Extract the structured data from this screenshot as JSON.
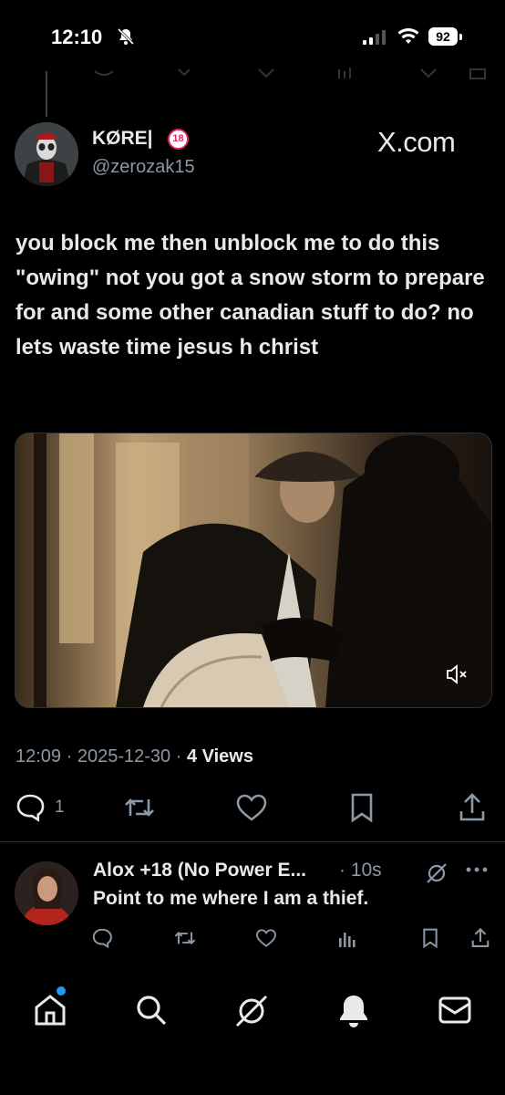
{
  "status_bar": {
    "time": "12:10",
    "battery": "92"
  },
  "tweet": {
    "author_name": "KØRE|",
    "age_badge": "18",
    "handle": "@zerozak15",
    "watermark": "X.com",
    "text": "you block me then unblock me to do this \"owing\" not you got a snow storm to prepare for and some other canadian stuff to do? no lets waste time jesus h christ",
    "time": "12:09",
    "date": "2025-12-30",
    "views_count": "4",
    "views_label": "Views",
    "reply_count": "1"
  },
  "reply": {
    "author_name": "Alox +18 (No Power E...",
    "time": "10s",
    "text": "Point to me where I am a thief."
  },
  "icons": {
    "status": [
      "bell-off-icon",
      "signal-icon",
      "wifi-icon",
      "battery-icon"
    ],
    "tweet_actions": [
      "reply-icon",
      "repost-icon",
      "like-icon",
      "bookmark-icon",
      "share-icon"
    ],
    "reply_actions": [
      "reply-icon",
      "repost-icon",
      "like-icon",
      "views-icon",
      "bookmark-icon",
      "share-icon"
    ],
    "bottom_nav": [
      "home-icon",
      "search-icon",
      "grok-icon",
      "notifications-icon",
      "messages-icon"
    ],
    "media": [
      "mute-icon"
    ]
  },
  "colors": {
    "background": "#000000",
    "text": "#e7e9ea",
    "muted": "#8b98a5",
    "accent": "#1d9bf0",
    "divider": "#2f3336"
  }
}
